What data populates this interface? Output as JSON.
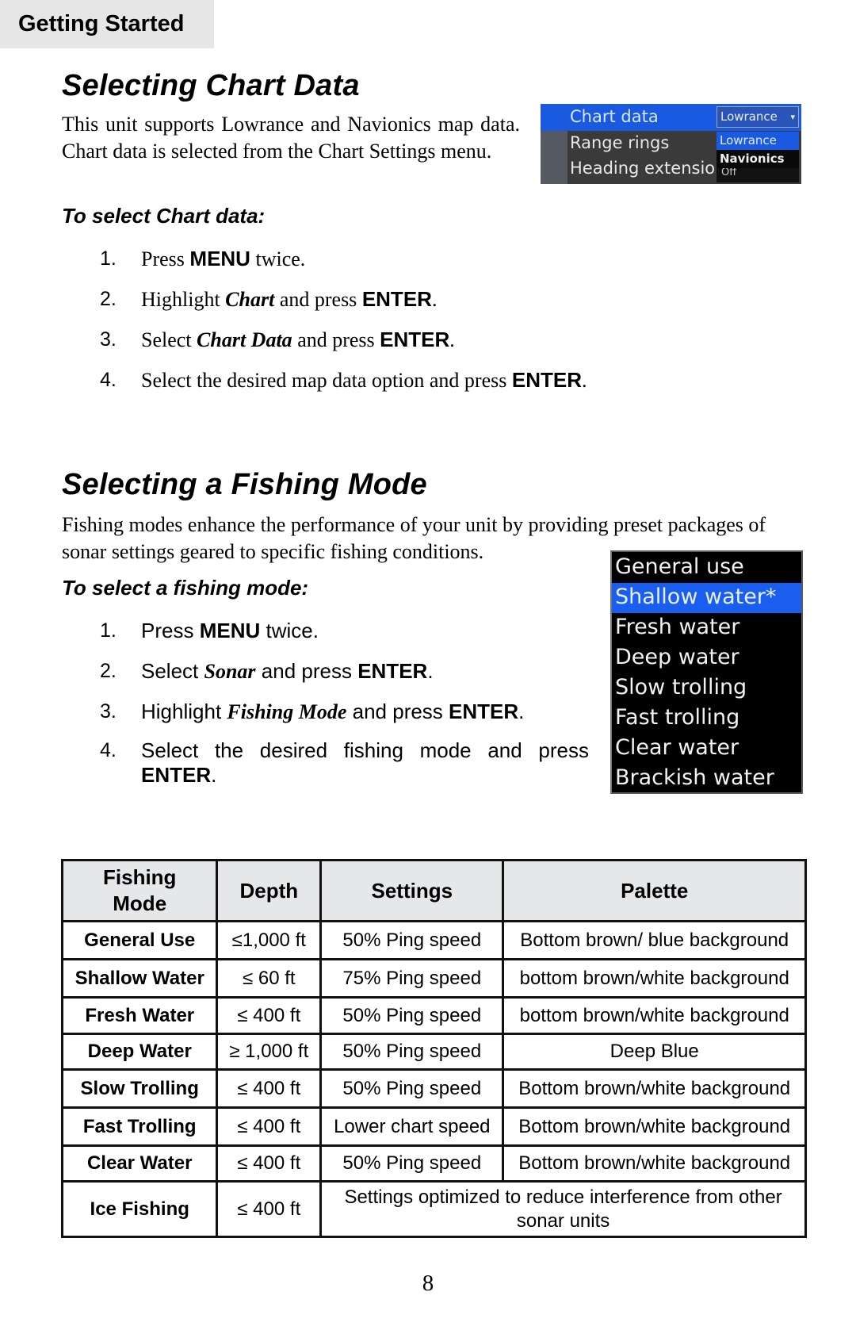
{
  "header": {
    "section_tab": "Getting Started"
  },
  "chart_section": {
    "title": "Selecting Chart Data",
    "intro": "This unit supports Lowrance and Navionics map data. Chart data is selected from the Chart Settings menu.",
    "subheading": "To select Chart data:",
    "steps": [
      {
        "num": "1.",
        "pre": "Press ",
        "key": "MENU",
        "mid": " twice.",
        "em": "",
        "post": ""
      },
      {
        "num": "2.",
        "pre": "Highlight ",
        "em": "Chart",
        "mid": " and press ",
        "key": "ENTER",
        "post": "."
      },
      {
        "num": "3.",
        "pre": "Select ",
        "em": "Chart Data",
        "mid": " and press ",
        "key": "ENTER",
        "post": "."
      },
      {
        "num": "4.",
        "pre": "Select the desired map data option and press ",
        "key": "ENTER",
        "post": "."
      }
    ],
    "screenshot": {
      "rows": [
        "Chart data",
        "Range rings",
        "Heading extension"
      ],
      "dropdown_current": "Lowrance",
      "dropdown_options": [
        "Lowrance",
        "Navionics"
      ],
      "heading_extension_value": "Off",
      "highlight_color": "#1a5ae0"
    }
  },
  "fishing_section": {
    "title": "Selecting a Fishing Mode",
    "intro": "Fishing modes enhance the performance of your unit by providing preset packages of sonar settings geared to specific fishing conditions.",
    "subheading": "To select a fishing mode:",
    "steps": [
      {
        "num": "1.",
        "pre": "Press ",
        "key": "MENU",
        "post": " twice."
      },
      {
        "num": "2.",
        "pre": "Select ",
        "em": "Sonar",
        "mid": " and press ",
        "key": "ENTER",
        "post": "."
      },
      {
        "num": "3.",
        "pre": "Highlight ",
        "em": "Fishing Mode",
        "mid": " and press ",
        "key": "ENTER",
        "post": "."
      },
      {
        "num": "4.",
        "pre": "Select the desired fishing mode and press ",
        "key": "ENTER",
        "post": "."
      }
    ],
    "mode_menu": {
      "items": [
        "General use",
        "Shallow water*",
        "Fresh water",
        "Deep water",
        "Slow trolling",
        "Fast trolling",
        "Clear water",
        "Brackish water"
      ],
      "selected_index": 1,
      "highlight_color": "#1a5ef0"
    }
  },
  "table": {
    "headers": [
      "Fishing Mode",
      "Depth",
      "Settings",
      "Palette"
    ],
    "header_mode_line1": "Fishing",
    "header_mode_line2": "Mode",
    "rows": [
      {
        "mode": "General Use",
        "depth": "≤1,000 ft",
        "settings": "50% Ping speed",
        "palette": "Bottom brown/ blue background"
      },
      {
        "mode": "Shallow Water",
        "depth": "≤ 60 ft",
        "settings": "75% Ping speed",
        "palette": "bottom brown/white background"
      },
      {
        "mode": "Fresh Water",
        "depth": "≤ 400 ft",
        "settings": "50% Ping speed",
        "palette": "bottom brown/white background"
      },
      {
        "mode": "Deep Water",
        "depth": "≥ 1,000 ft",
        "settings": "50% Ping speed",
        "palette": "Deep Blue"
      },
      {
        "mode": "Slow Trolling",
        "depth": "≤ 400 ft",
        "settings": "50% Ping speed",
        "palette": "Bottom brown/white background"
      },
      {
        "mode": "Fast Trolling",
        "depth": "≤ 400 ft",
        "settings": "Lower chart speed",
        "palette": "Bottom brown/white background"
      },
      {
        "mode": "Clear Water",
        "depth": "≤ 400 ft",
        "settings": "50% Ping speed",
        "palette": "Bottom brown/white background"
      },
      {
        "mode": "Ice Fishing",
        "depth": "≤ 400 ft",
        "combined": "Settings optimized to reduce interference from other sonar units"
      }
    ]
  },
  "footer": {
    "page_number": "8"
  }
}
